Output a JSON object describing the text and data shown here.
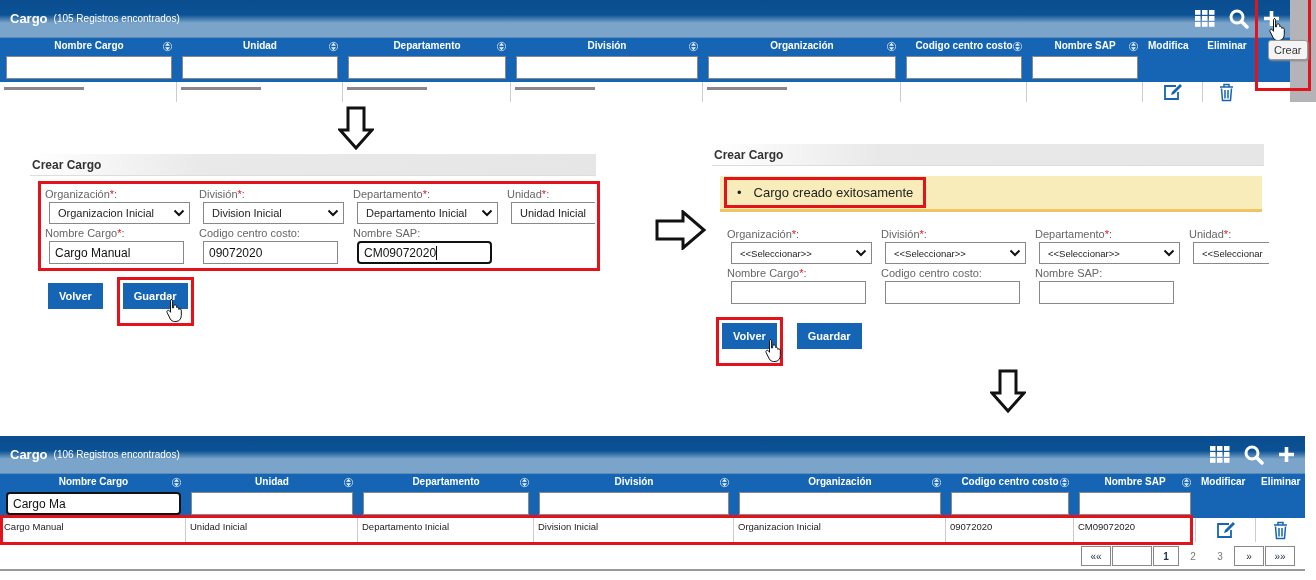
{
  "list_before": {
    "title": "Cargo",
    "count": "(105 Registros encontrados)",
    "toolbar": [
      {
        "kind": "columns"
      },
      {
        "kind": "search"
      },
      {
        "kind": "add",
        "highlighted": true,
        "cursor": true,
        "tooltip": "Crear"
      }
    ],
    "columns": [
      {
        "label": "Nombre Cargo",
        "kind": "filter"
      },
      {
        "label": "Unidad",
        "kind": "filter"
      },
      {
        "label": "Departamento",
        "kind": "filter"
      },
      {
        "label": "División",
        "kind": "filter"
      },
      {
        "label": "Organización",
        "kind": "filter"
      },
      {
        "label": "Codigo centro costo",
        "kind": "filter"
      },
      {
        "label": "Nombre SAP",
        "kind": "filter"
      },
      {
        "label": "Modifica",
        "kind": "action"
      },
      {
        "label": "Eliminar",
        "kind": "action"
      }
    ],
    "rows_cut_off": true
  },
  "create_form": {
    "title": "Crear Cargo",
    "fields_highlighted": true,
    "fields": [
      {
        "label": "Organización",
        "mark": "*",
        "suffix": ":",
        "kind": "select",
        "value": "Organizacion Inicial",
        "cut_off": false
      },
      {
        "label": "División",
        "mark": "*",
        "suffix": ":",
        "kind": "select",
        "value": "Division Inicial",
        "cut_off": false
      },
      {
        "label": "Departamento",
        "mark": "*",
        "suffix": ":",
        "kind": "select",
        "value": "Departamento Inicial",
        "cut_off": false
      },
      {
        "label": "Unidad",
        "mark": "*",
        "suffix": ":",
        "kind": "select",
        "value": "Unidad Inicial",
        "cut_off": true
      },
      {
        "label": "Nombre Cargo",
        "mark": "*",
        "suffix": ":",
        "kind": "text",
        "value": "Cargo Manual"
      },
      {
        "label": "Codigo centro costo",
        "suffix": ":",
        "kind": "text",
        "value": "09072020"
      },
      {
        "label": "Nombre SAP",
        "suffix": ":",
        "kind": "text",
        "value": "CM09072020",
        "focused": true
      }
    ],
    "buttons": [
      {
        "label": "Volver",
        "highlighted": false,
        "cursor": false
      },
      {
        "label": "Guardar",
        "highlighted": true,
        "cursor": true
      }
    ]
  },
  "created_form": {
    "title": "Crear Cargo",
    "message": {
      "bullet": "•",
      "text": "Cargo creado exitosamente",
      "highlighted": true
    },
    "fields_highlighted": false,
    "fields": [
      {
        "label": "Organización",
        "mark": "*",
        "suffix": ":",
        "kind": "select",
        "value": "<<Seleccionar>>",
        "cut_off": false
      },
      {
        "label": "División",
        "mark": "*",
        "suffix": ":",
        "kind": "select",
        "value": "<<Seleccionar>>",
        "cut_off": false
      },
      {
        "label": "Departamento",
        "mark": "*",
        "suffix": ":",
        "kind": "select",
        "value": "<<Seleccionar>>",
        "cut_off": false
      },
      {
        "label": "Unidad",
        "mark": "*",
        "suffix": ":",
        "kind": "select",
        "value": "<<Seleccionar",
        "cut_off": true
      },
      {
        "label": "Nombre Cargo",
        "mark": "*",
        "suffix": ":",
        "kind": "text"
      },
      {
        "label": "Codigo centro costo",
        "suffix": ":",
        "kind": "text"
      },
      {
        "label": "Nombre SAP",
        "suffix": ":",
        "kind": "text"
      }
    ],
    "buttons": [
      {
        "label": "Volver",
        "highlighted": true,
        "cursor": true
      },
      {
        "label": "Guardar",
        "highlighted": false,
        "cursor": false
      }
    ]
  },
  "list_after": {
    "title": "Cargo",
    "count": "(106 Registros encontrados)",
    "toolbar": [
      {
        "kind": "columns"
      },
      {
        "kind": "search"
      },
      {
        "kind": "add"
      }
    ],
    "columns": [
      {
        "label": "Nombre Cargo",
        "kind": "filter",
        "filter": "Cargo Ma",
        "focused": true
      },
      {
        "label": "Unidad",
        "kind": "filter"
      },
      {
        "label": "Departamento",
        "kind": "filter"
      },
      {
        "label": "División",
        "kind": "filter"
      },
      {
        "label": "Organización",
        "kind": "filter"
      },
      {
        "label": "Codigo centro costo",
        "kind": "filter"
      },
      {
        "label": "Nombre SAP",
        "kind": "filter"
      },
      {
        "label": "Modificar",
        "kind": "action"
      },
      {
        "label": "Eliminar",
        "kind": "action"
      }
    ],
    "rows": [
      {
        "cells": [
          "Cargo Manual",
          "Unidad Inicial",
          "Departamento Inicial",
          "Division Inicial",
          "Organizacion Inicial",
          "09072020",
          "CM09072020"
        ],
        "highlighted": true
      }
    ],
    "pagination": [
      {
        "label": "««",
        "kind": "nav"
      },
      {
        "kind": "blank"
      },
      {
        "label": "1",
        "kind": "page",
        "selected": true
      },
      {
        "label": "2",
        "kind": "page",
        "selected": false
      },
      {
        "label": "3",
        "kind": "page",
        "selected": false
      },
      {
        "label": "»",
        "kind": "nav"
      },
      {
        "label": "»»",
        "kind": "nav"
      }
    ]
  }
}
